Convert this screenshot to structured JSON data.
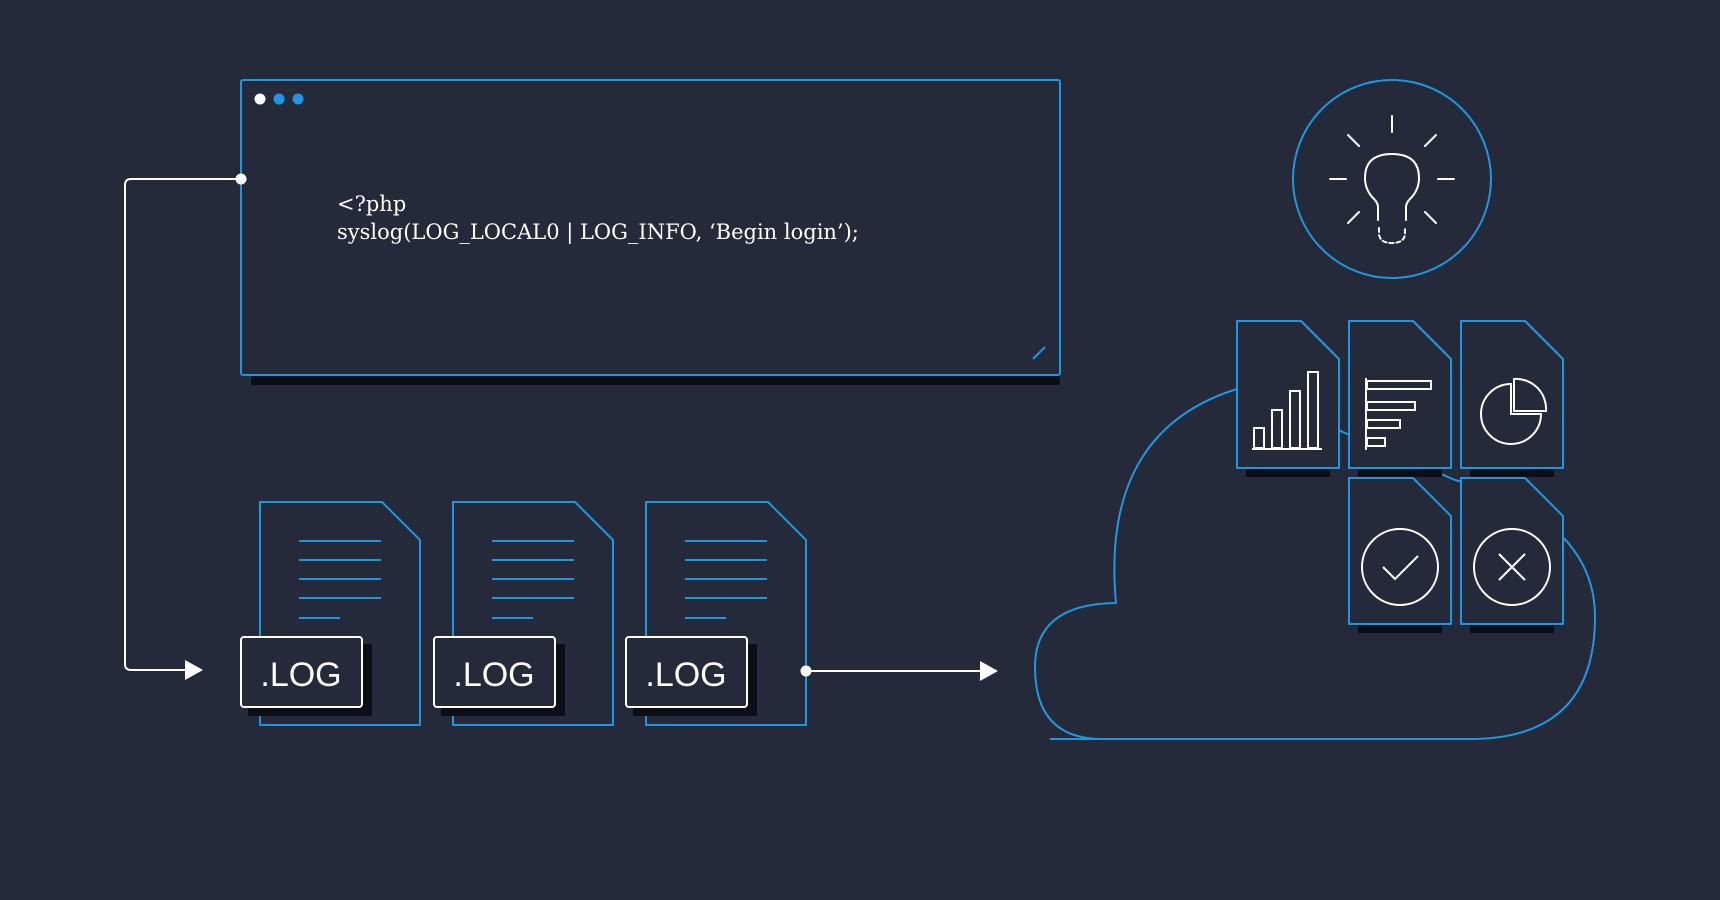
{
  "code_window": {
    "line1": "<?php",
    "line2": "syslog(LOG_LOCAL0 | LOG_INFO, ‘Begin login’);"
  },
  "log_files": [
    {
      "label": ".LOG"
    },
    {
      "label": ".LOG"
    },
    {
      "label": ".LOG"
    }
  ],
  "colors": {
    "background": "#252a3a",
    "accent": "#1f97e0",
    "line": "#ffffff",
    "shadow": "#0b0e16"
  }
}
